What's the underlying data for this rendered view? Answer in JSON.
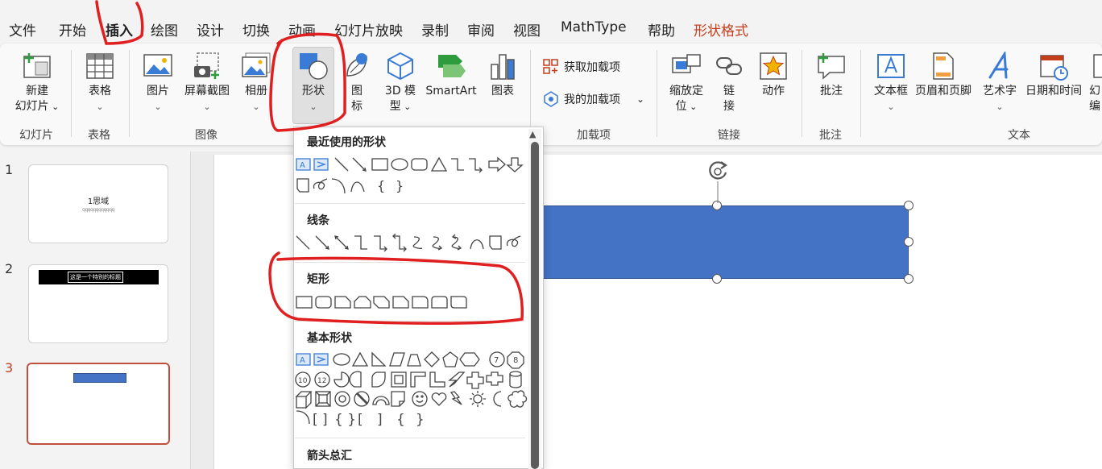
{
  "menu": {
    "items": [
      "文件",
      "开始",
      "插入",
      "绘图",
      "设计",
      "切换",
      "动画",
      "幻灯片放映",
      "录制",
      "审阅",
      "视图",
      "MathType",
      "帮助",
      "形状格式"
    ]
  },
  "ribbon": {
    "slides_group": {
      "new_slide_line1": "新建",
      "new_slide_line2": "幻灯片",
      "label": "幻灯片"
    },
    "table_group": {
      "table": "表格",
      "label": "表格"
    },
    "image_group": {
      "picture": "图片",
      "screenshot": "屏幕截图",
      "album": "相册",
      "label": "图像"
    },
    "illustrations": {
      "shapes": "形状",
      "icons_line1": "图",
      "icons_line2": "标",
      "model_line1": "3D 模",
      "model_line2": "型",
      "smartart": "SmartArt",
      "chart": "图表"
    },
    "addins_group": {
      "get_addins": "获取加载项",
      "my_addins": "我的加载项",
      "label": "加载项"
    },
    "links_group": {
      "zoom_line1": "缩放定",
      "zoom_line2": "位",
      "link_line1": "链",
      "link_line2": "接",
      "action": "动作",
      "label": "链接"
    },
    "comments_group": {
      "comment": "批注",
      "label": "批注"
    },
    "text_group": {
      "textbox": "文本框",
      "header_footer": "页眉和页脚",
      "wordart": "艺术字",
      "datetime": "日期和时间",
      "more_line1": "幻",
      "more_line2": "编",
      "label": "文本"
    }
  },
  "slides": [
    {
      "number": "1",
      "title": "1思域",
      "subtitle": "qqqqqqqqqqqq"
    },
    {
      "number": "2",
      "title": "这是一个特别的标题"
    },
    {
      "number": "3"
    }
  ],
  "gallery": {
    "recent": "最近使用的形状",
    "lines": "线条",
    "rectangles": "矩形",
    "basic": "基本形状",
    "arrows": "箭头总汇",
    "basic_numbers": [
      "7",
      "8",
      "10",
      "12"
    ]
  },
  "colors": {
    "accent": "#c43e1c",
    "shape_fill": "#4472c4",
    "annotation": "#e02020"
  }
}
